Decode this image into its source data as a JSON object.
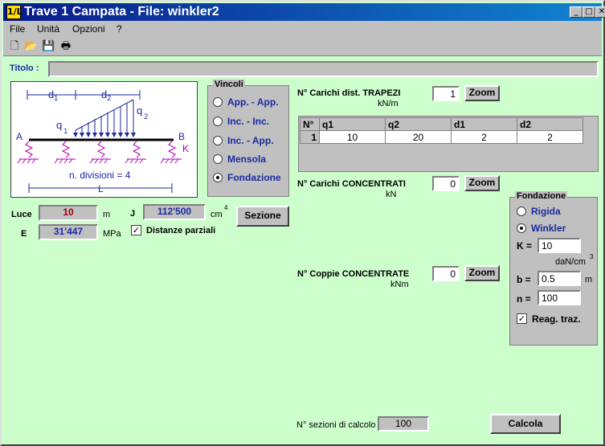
{
  "window": {
    "title": "Trave 1 Campata - File: winkler2",
    "app_icon": "1/L",
    "controls": {
      "minimize": "_",
      "maximize": "□",
      "close": "✕"
    }
  },
  "menu": [
    "File",
    "Unità",
    "Opzioni",
    "?"
  ],
  "titolo": {
    "label": "Titolo :",
    "value": ""
  },
  "diagram": {
    "d1": "d",
    "d1_sub": "1",
    "d2": "d",
    "d2_sub": "2",
    "q1": "q",
    "q1_sub": "1",
    "q2": "q",
    "q2_sub": "2",
    "A": "A",
    "B": "B",
    "K": "K",
    "divisions": "n. divisioni = 4",
    "L": "L"
  },
  "vincoli": {
    "title": "Vincoli",
    "options": [
      "App. - App.",
      "Inc. - Inc.",
      "Inc. - App.",
      "Mensola",
      "Fondazione"
    ],
    "selected_index": 4
  },
  "luce": {
    "label": "Luce",
    "value": "10",
    "unit": "m"
  },
  "J": {
    "label": "J",
    "value": "112'500",
    "unit": "cm",
    "unit_sup": "4"
  },
  "E": {
    "label": "E",
    "value": "31'447",
    "unit": "MPa"
  },
  "sezione_button": "Sezione",
  "distanze_parziali": {
    "label": "Distanze parziali",
    "checked": true
  },
  "carichi_trapezi": {
    "label": "N° Carichi dist. TRAPEZI",
    "unit": "kN/m",
    "value": "1",
    "zoom": "Zoom",
    "headers": [
      "N°",
      "q1",
      "q2",
      "d1",
      "d2"
    ],
    "rows": [
      [
        "1",
        "10",
        "20",
        "2",
        "2"
      ]
    ]
  },
  "carichi_concentrati": {
    "label": "N° Carichi CONCENTRATI",
    "unit": "kN",
    "value": "0",
    "zoom": "Zoom"
  },
  "coppie_concentrate": {
    "label": "N° Coppie CONCENTRATE",
    "unit": "kNm",
    "value": "0",
    "zoom": "Zoom"
  },
  "fondazione": {
    "title": "Fondazione",
    "options": [
      "Rigida",
      "Winkler"
    ],
    "selected_index": 1,
    "K_label": "K =",
    "K_value": "10",
    "K_unit": "daN/cm",
    "K_unit_sup": "3",
    "b_label": "b =",
    "b_value": "0.5",
    "b_unit": "m",
    "n_label": "n =",
    "n_value": "100",
    "reag_traz": {
      "label": "Reag. traz.",
      "checked": true
    }
  },
  "sezioni_calcolo": {
    "label": "N° sezioni di calcolo",
    "value": "100"
  },
  "calcola_button": "Calcola",
  "colors": {
    "background": "#ccffcc",
    "title_from": "#0a1a8c",
    "title_to": "#1084d0",
    "luce_value": "#a00000",
    "value_blue": "#1a2aa0"
  }
}
